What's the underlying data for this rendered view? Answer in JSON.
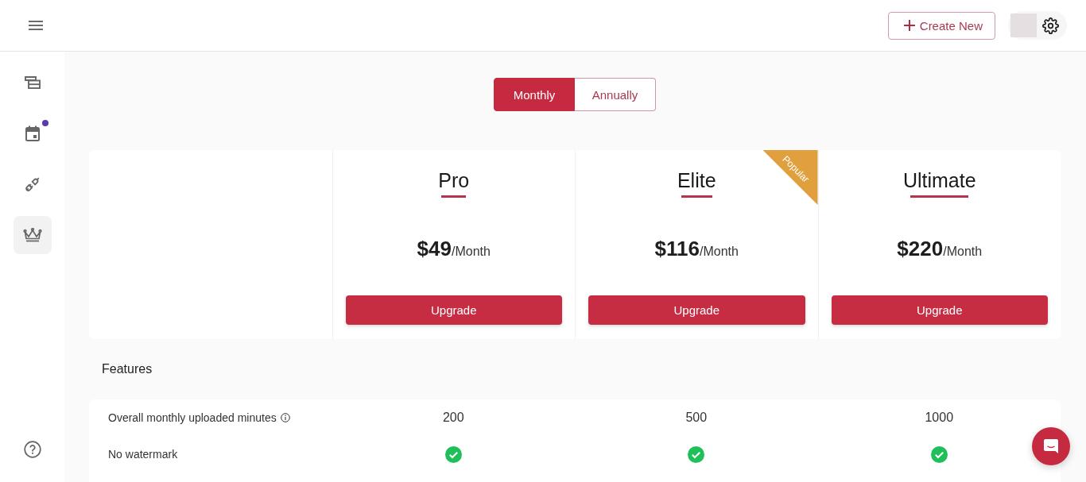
{
  "header": {
    "create_button": {
      "label": "Create New"
    }
  },
  "sidebar": {
    "items": [
      {
        "kind": "layers",
        "selected": false,
        "notification": false
      },
      {
        "kind": "calendar",
        "selected": false,
        "notification": true
      },
      {
        "kind": "plug",
        "selected": false,
        "notification": false
      },
      {
        "kind": "crown",
        "selected": true,
        "notification": false
      }
    ]
  },
  "billing_period": [
    {
      "label": "Monthly",
      "selected": true
    },
    {
      "label": "Annually",
      "selected": false
    }
  ],
  "plans": [
    {
      "name": "Pro",
      "price": "$49",
      "period": "/Month",
      "button": "Upgrade"
    },
    {
      "name": "Elite",
      "price": "$116",
      "period": "/Month",
      "button": "Upgrade",
      "ribbon": "Popular"
    },
    {
      "name": "Ultimate",
      "price": "$220",
      "period": "/Month",
      "button": "Upgrade"
    }
  ],
  "features": {
    "title": "Features",
    "rows": [
      {
        "kind": "value",
        "label": "Overall monthly uploaded minutes",
        "info": true,
        "values": [
          "200",
          "500",
          "1000"
        ]
      },
      {
        "kind": "check",
        "label": "No watermark",
        "info": false,
        "values": [
          true,
          true,
          true
        ]
      }
    ]
  }
}
